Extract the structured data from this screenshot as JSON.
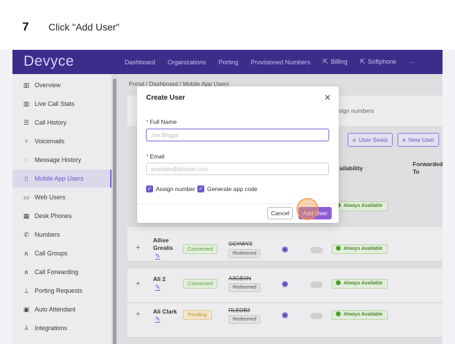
{
  "step": {
    "number": "7",
    "instruction": "Click \"Add User\""
  },
  "app": {
    "logo": "Devyce",
    "nav": [
      "Dashboard",
      "Organizations",
      "Porting",
      "Provisioned Numbers",
      "Billing",
      "Softphone",
      "···"
    ]
  },
  "sidebar": {
    "items": [
      {
        "label": "Overview",
        "icon": "chart-icon"
      },
      {
        "label": "Live Call Stats",
        "icon": "chart-icon"
      },
      {
        "label": "Call History",
        "icon": "list-icon"
      },
      {
        "label": "Voicemails",
        "icon": "voicemail-icon"
      },
      {
        "label": "Message History",
        "icon": "message-icon"
      },
      {
        "label": "Mobile App Users",
        "icon": "mobile-icon",
        "active": true
      },
      {
        "label": "Web Users",
        "icon": "monitor-icon"
      },
      {
        "label": "Desk Phones",
        "icon": "phone-icon"
      },
      {
        "label": "Numbers",
        "icon": "numbers-icon"
      },
      {
        "label": "Call Groups",
        "icon": "group-icon"
      },
      {
        "label": "Call Forwarding",
        "icon": "forward-icon"
      },
      {
        "label": "Porting Requests",
        "icon": "porting-icon"
      },
      {
        "label": "Auto Attendant",
        "icon": "attendant-icon"
      },
      {
        "label": "Integrations",
        "icon": "integration-icon"
      }
    ]
  },
  "breadcrumb": "Portal / Dashboard / Mobile App Users",
  "main": {
    "assign_text": "sign numbers",
    "user_seats_label": "User Seats",
    "new_user_label": "New User",
    "col_availability": "ailability",
    "col_forwarded": "Forwarded To",
    "rows": [
      {
        "name": "Ailise Grealis",
        "status": "Connected",
        "code": "CCYWY3",
        "redeemed": "Redeemed",
        "availability": "Always Available"
      },
      {
        "name": "Ali 2",
        "status": "Connected",
        "code": "A3GBXN",
        "redeemed": "Redeemed",
        "availability": "Always Available"
      },
      {
        "name": "Ali Clark",
        "status": "Pending",
        "code": "RLEDB3",
        "redeemed": "Redeemed",
        "availability": "Always Available"
      }
    ],
    "partial_row_availability": "Always Available"
  },
  "modal": {
    "title": "Create User",
    "full_name_label": "Full Name",
    "full_name_placeholder": "Joe Bloggs",
    "email_label": "Email",
    "email_placeholder": "example@domain.com",
    "assign_number_label": "Assign number",
    "generate_code_label": "Generate app code",
    "cancel_label": "Cancel",
    "add_user_label": "Add User"
  },
  "colors": {
    "brand": "#3c2d8a",
    "accent": "#6b58c9",
    "add_button": "#8e5dd8"
  }
}
